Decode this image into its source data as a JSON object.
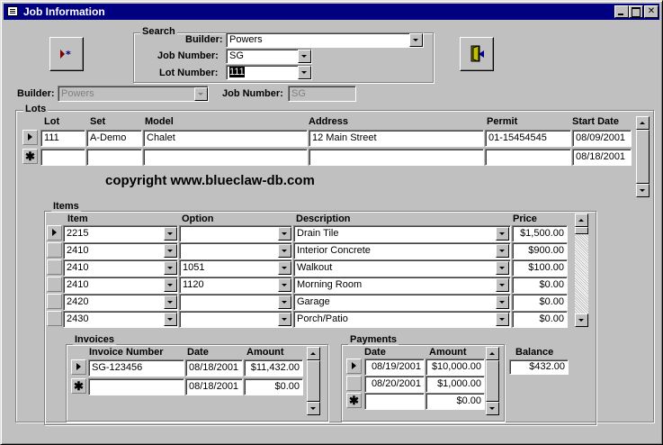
{
  "window": {
    "title": "Job Information",
    "controls": [
      "minimize-icon",
      "maximize-icon",
      "close-icon"
    ]
  },
  "search": {
    "frame_label": "Search",
    "builder_label": "Builder:",
    "builder_value": "Powers",
    "job_label": "Job Number:",
    "job_value": "SG",
    "lot_label": "Lot Number:",
    "lot_value": "111"
  },
  "header": {
    "builder_label": "Builder:",
    "builder_value": "Powers",
    "job_label": "Job Number:",
    "job_value": "SG"
  },
  "lots": {
    "frame_label": "Lots",
    "columns": [
      "Lot",
      "Set",
      "Model",
      "Address",
      "Permit",
      "Start Date"
    ],
    "rows": [
      {
        "lot": "111",
        "set": "A-Demo",
        "model": "Chalet",
        "address": "12 Main Street",
        "permit": "01-15454545",
        "start": "08/09/2001"
      },
      {
        "lot": "",
        "set": "",
        "model": "",
        "address": "",
        "permit": "",
        "start": "08/18/2001"
      }
    ]
  },
  "copyright": "copyright www.blueclaw-db.com",
  "items": {
    "frame_label": "Items",
    "columns": [
      "Item",
      "Option",
      "Description",
      "Price"
    ],
    "rows": [
      {
        "item": "2215",
        "option": "",
        "description": "Drain Tile",
        "price": "$1,500.00"
      },
      {
        "item": "2410",
        "option": "",
        "description": "Interior Concrete",
        "price": "$900.00"
      },
      {
        "item": "2410",
        "option": "1051",
        "description": "Walkout",
        "price": "$100.00"
      },
      {
        "item": "2410",
        "option": "1120",
        "description": "Morning Room",
        "price": "$0.00"
      },
      {
        "item": "2420",
        "option": "",
        "description": "Garage",
        "price": "$0.00"
      },
      {
        "item": "2430",
        "option": "",
        "description": "Porch/Patio",
        "price": "$0.00"
      }
    ]
  },
  "invoices": {
    "frame_label": "Invoices",
    "columns": [
      "Invoice Number",
      "Date",
      "Amount"
    ],
    "rows": [
      {
        "number": "SG-123456",
        "date": "08/18/2001",
        "amount": "$11,432.00"
      },
      {
        "number": "",
        "date": "08/18/2001",
        "amount": "$0.00"
      }
    ]
  },
  "payments": {
    "frame_label": "Payments",
    "columns": [
      "Date",
      "Amount"
    ],
    "rows": [
      {
        "date": "08/19/2001",
        "amount": "$10,000.00"
      },
      {
        "date": "08/20/2001",
        "amount": "$1,000.00"
      },
      {
        "date": "",
        "amount": "$0.00"
      }
    ]
  },
  "balance": {
    "label": "Balance",
    "value": "$432.00"
  },
  "buttons": {
    "left_icon": "record-navigation-icon",
    "right_icon": "exit-door-icon"
  },
  "colors": {
    "titlebar": "#000080",
    "face": "#c0c0c0",
    "field": "#ffffff"
  }
}
